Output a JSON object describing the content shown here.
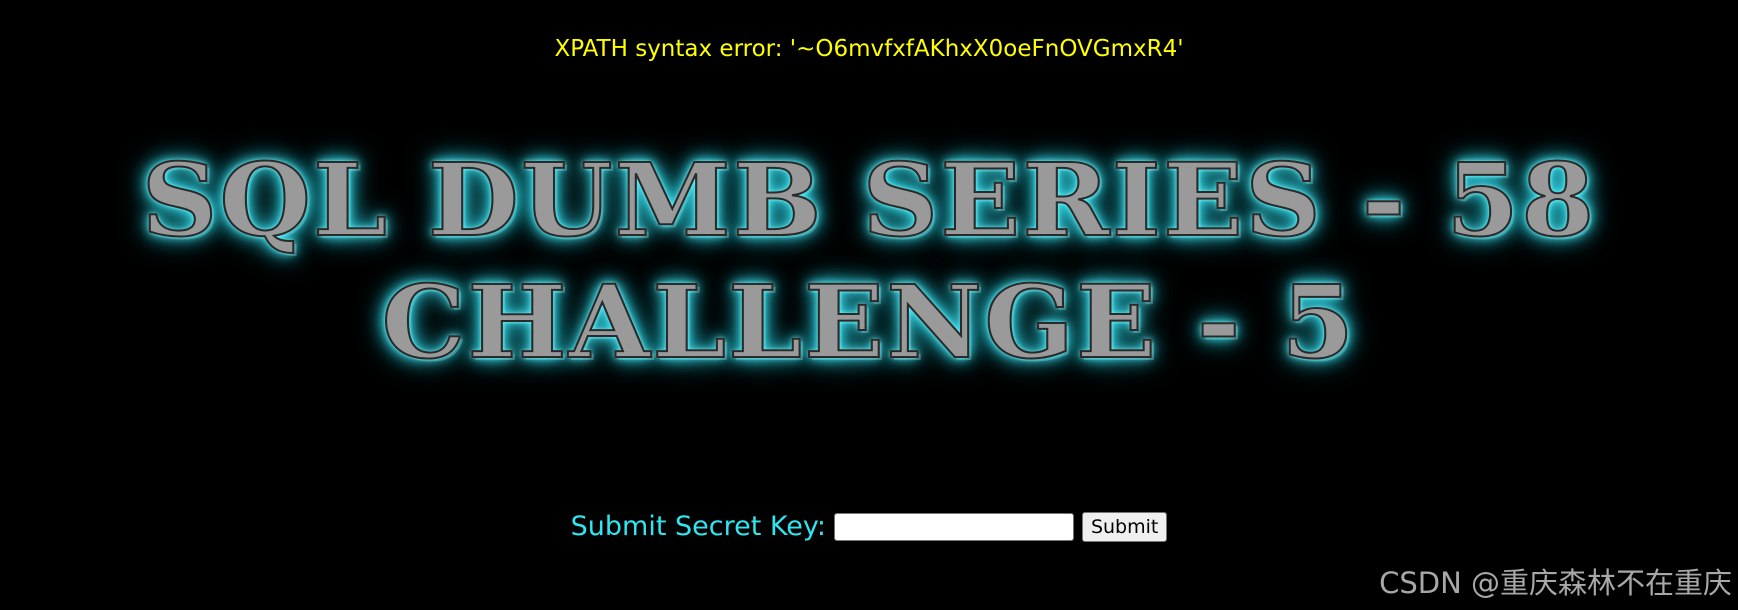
{
  "error": {
    "message": "XPATH syntax error: '~O6mvfxfAKhxX0oeFnOVGmxR4'",
    "color": "#ffff00"
  },
  "banner": {
    "line1": "SQL DUMB SERIES - 58",
    "line2": "CHALLENGE - 5",
    "glow_color": "#4ff0ff"
  },
  "form": {
    "label": "Submit Secret Key:",
    "input_value": "",
    "submit_label": "Submit",
    "label_color": "#2fe6f0"
  },
  "watermark": {
    "text": "CSDN @重庆森林不在重庆"
  }
}
